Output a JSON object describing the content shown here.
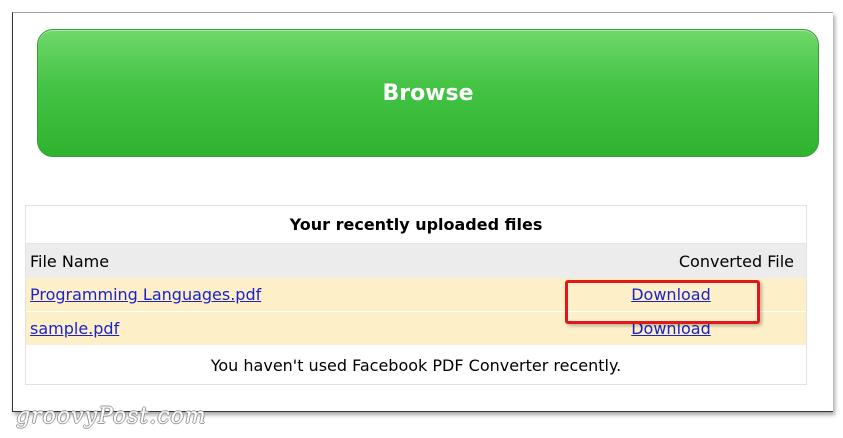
{
  "browse": {
    "label": "Browse",
    "colors": {
      "top": "#6fd86a",
      "bottom": "#2fb32f"
    }
  },
  "recent_files": {
    "title": "Your recently uploaded files",
    "headers": {
      "file_name": "File Name",
      "converted_file": "Converted File"
    },
    "rows": [
      {
        "file_name": "Programming Languages.pdf",
        "converted": "Download"
      },
      {
        "file_name": "sample.pdf",
        "converted": "Download"
      }
    ],
    "footer": "You haven't used Facebook PDF Converter recently."
  },
  "highlight": {
    "color": "#e0171c",
    "target": "Download"
  },
  "watermark": {
    "text": "groovyPost.com"
  },
  "colors": {
    "link": "#1a24c8",
    "row_bg": "#fdefc8",
    "header_bg": "#ececec"
  }
}
